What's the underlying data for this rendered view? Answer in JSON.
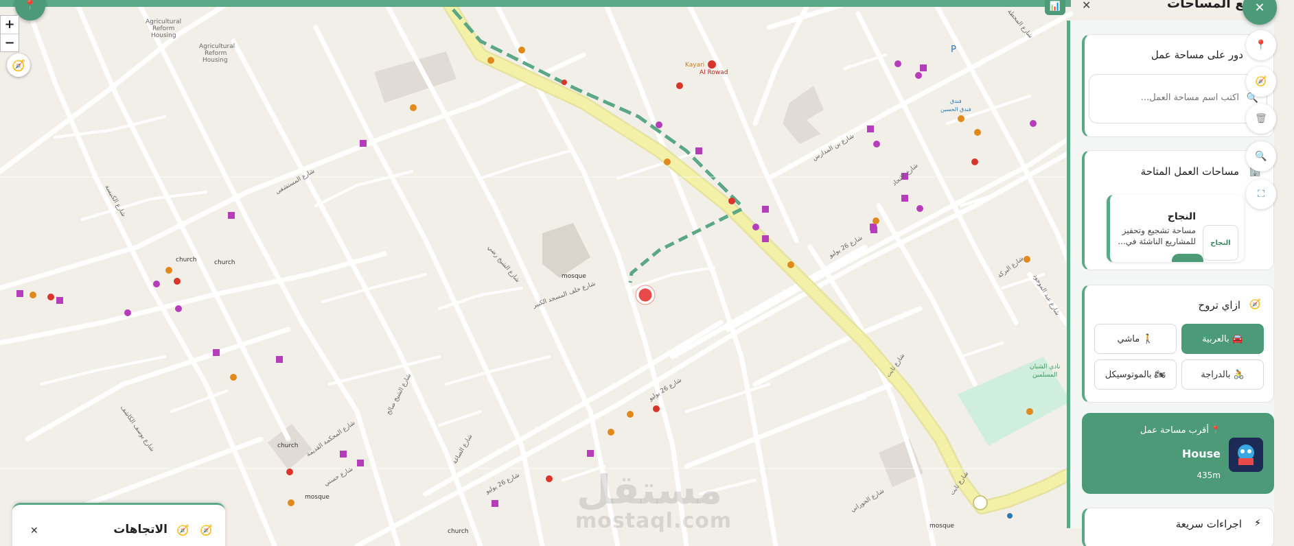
{
  "map": {
    "zoom_in": "+",
    "zoom_out": "−",
    "labels": {
      "agri1": "Agricultural",
      "agri2": "Reform",
      "agri3": "Housing",
      "agri4": "Agricultural",
      "agri5": "Reform",
      "agri6": "Housing",
      "kayari": "Kayari",
      "alrowad": "Al Rowad",
      "church1": "church",
      "church2": "church",
      "church3": "church",
      "church4": "church",
      "mosque1": "mosque",
      "mosque2": "mosque",
      "mosque3": "mosque",
      "hotel1": "فندق",
      "hotel2": "فندق الحسين",
      "club1": "نادي الشبان",
      "club2": "المسلمين",
      "st1": "شارع 26 يوليو",
      "st2": "شارع 26 يوليو",
      "st3": "شارع 26 يوليو",
      "st4": "شارع ثابت",
      "st5": "شارع ثابت",
      "st6": "شارع بن المدارس",
      "st7": "شارع الحوراني",
      "st8": "شارع المحكمة القديمة",
      "st9": "شارع خلف المسجد الكبير",
      "st10": "شارع المستشفى",
      "st11": "شارع الكنيسة",
      "st12": "شارع الشيخ صالح",
      "st13": "شارع الاتحاد",
      "st14": "شارع الشيخ رضي",
      "st15": "شارع المحطة",
      "st16": "شارع البركة",
      "st17": "شارع عبد الموجود",
      "st18": "شارع حسني",
      "st19": "شارع يوسف الكاشف",
      "st20": "شارع الصاغة"
    }
  },
  "watermark": {
    "main": "مستقل",
    "sub": "mostaql.com"
  },
  "directions": {
    "title": "الاتجاهات",
    "close": "✕"
  },
  "panel": {
    "title": "توزيع المساحات",
    "close": "✕",
    "search_section": {
      "title": "دور على مساحة عمل",
      "placeholder": "اكتب اسم مساحة العمل..."
    },
    "available_section": {
      "title": "مساحات العمل المتاحة",
      "item": {
        "name": "النجاح",
        "desc": "مساحة تشجيع وتحفيز للمشاريع الناشئة في...",
        "logo": "النجاح"
      }
    },
    "travel_section": {
      "title": "ازاي تروح",
      "modes": [
        {
          "label": "بالعربية",
          "icon": "🚘",
          "active": true
        },
        {
          "label": "ماشي",
          "icon": "🚶",
          "active": false
        },
        {
          "label": "بالدراجة",
          "icon": "🚴",
          "active": false
        },
        {
          "label": "بالموتوسيكل",
          "icon": "🏍",
          "active": false
        }
      ]
    },
    "nearest": {
      "title": "أقرب مساحة عمل",
      "name": "House",
      "distance": "435m"
    },
    "quick_section": {
      "title": "اجراءات سريعة"
    }
  },
  "colors": {
    "brand": "#4c9a78",
    "route": "#5aa885",
    "main_road": "#f3f0a8"
  }
}
